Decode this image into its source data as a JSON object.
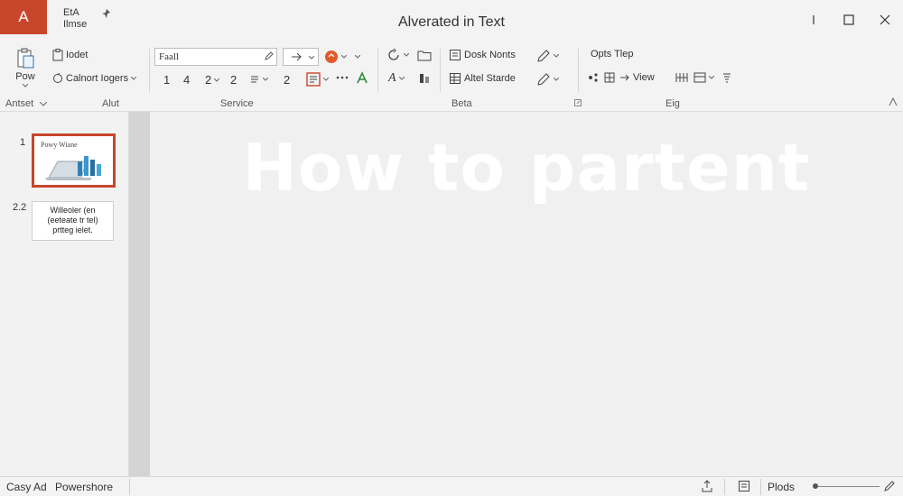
{
  "app": {
    "badge": "A",
    "window_title": "Alverated in Text"
  },
  "title_bar": {
    "file_line1": "EtA",
    "file_line2": "Ilmse"
  },
  "ribbon": {
    "paste_label": "Pow",
    "cmd_insert": "Iodet",
    "cmd_layout": "Calnort Iogers",
    "font_name": "Faall",
    "font_nums": [
      "1",
      "4",
      "2",
      "2",
      "2"
    ],
    "cmd_dusk": "Dosk Nonts",
    "cmd_artel": "Altel Starde",
    "cmd_opts": "Opts Tlep",
    "cmd_view": "View",
    "groups": {
      "antset": "Antset",
      "alut": "Alut",
      "service": "Service",
      "beta": "Beta",
      "eig": "Eig"
    }
  },
  "slides": {
    "thumb1_num": "1",
    "thumb1_title": "Powy Wiane",
    "thumb2_num": "2.2",
    "thumb2_lines": [
      "Willeoler (en",
      "(eeteate tr tel)",
      "prtteg ielet."
    ]
  },
  "slide": {
    "title": "How to partent"
  },
  "status": {
    "left1": "Casy Ad",
    "left2": "Powershore",
    "zoom_label": "Plods"
  },
  "colors": {
    "accent": "#c8462b",
    "slide_title": "#ffffff"
  },
  "icons": [
    "pin-icon",
    "minimize-icon",
    "maximize-icon",
    "close-icon",
    "paste-icon",
    "clipboard-icon",
    "chevron-down-icon",
    "pencil-icon",
    "arrow-icon",
    "color-circle-icon",
    "text-box-icon",
    "ellipsis-icon",
    "font-color-icon",
    "refresh-icon",
    "folder-icon",
    "document-icon",
    "pen-icon",
    "highlight-icon",
    "table-icon",
    "grid-icon",
    "list-icon",
    "share-icon",
    "notes-icon",
    "zoom-icon"
  ]
}
